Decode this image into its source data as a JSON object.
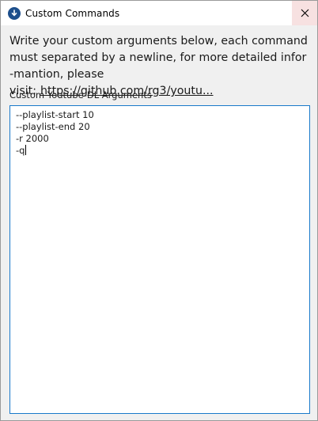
{
  "window": {
    "title": "Custom Commands",
    "close_glyph": "✕"
  },
  "description": {
    "line1": "Write your custom arguments below, each command",
    "line2": "must separated by a newline, for more detailed infor",
    "line3_prefix": "-mantion, please visit:",
    "link_text": "https://github.com/rg3/youtu..."
  },
  "field": {
    "label": "Custom Youtube-DL Arguments",
    "lines": [
      "--playlist-start 10",
      "--playlist-end 20",
      "-r 2000",
      "-q"
    ]
  },
  "colors": {
    "accent": "#1979ca",
    "close_hover_bg": "#f7e1e1",
    "icon_bg": "#1d4f8c"
  },
  "icons": {
    "app": "download-arrow-icon",
    "close": "close-icon"
  }
}
